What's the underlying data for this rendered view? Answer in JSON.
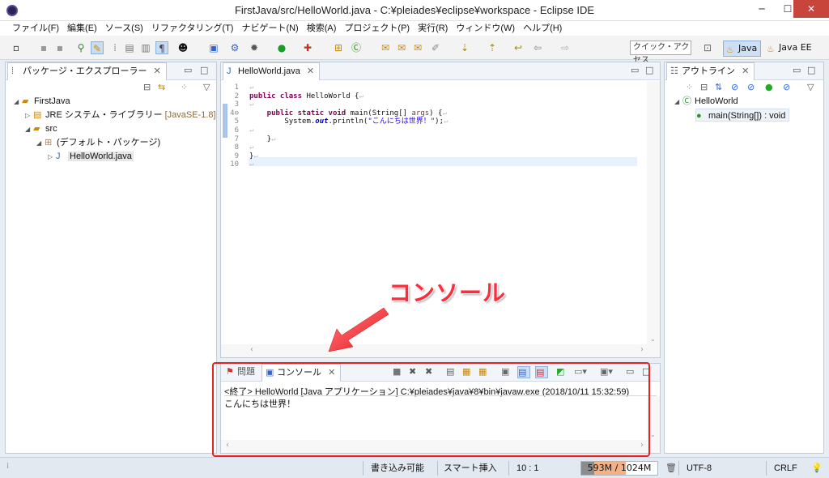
{
  "window": {
    "title": "FirstJava/src/HelloWorld.java - C:¥pleiades¥eclipse¥workspace - Eclipse IDE"
  },
  "menu": [
    "ファイル(F)",
    "編集(E)",
    "ソース(S)",
    "リファクタリング(T)",
    "ナビゲート(N)",
    "検索(A)",
    "プロジェクト(P)",
    "実行(R)",
    "ウィンドウ(W)",
    "ヘルプ(H)"
  ],
  "toolbar": {
    "quick_access": "クイック・アクセス",
    "perspectives": [
      "Java",
      "Java EE"
    ]
  },
  "package_explorer": {
    "tab": "パッケージ・エクスプローラー",
    "tree": [
      {
        "label": "FirstJava",
        "icon": "project-icon"
      },
      {
        "label": "JRE システム・ライブラリー",
        "suffix": "[JavaSE-1.8]",
        "icon": "library-icon"
      },
      {
        "label": "src",
        "icon": "source-folder-icon"
      },
      {
        "label": "(デフォルト・パッケージ)",
        "icon": "package-icon"
      },
      {
        "label": "HelloWorld.java",
        "icon": "java-file-icon"
      }
    ]
  },
  "editor": {
    "tab": "HelloWorld.java",
    "line_numbers": [
      "1",
      "2",
      "3",
      "4⊖",
      "5",
      "6",
      "7",
      "8",
      "9",
      "10"
    ],
    "lines": [
      {
        "parts": []
      },
      {
        "parts": [
          {
            "t": "public class ",
            "c": "kw"
          },
          {
            "t": "HelloWorld {",
            "c": ""
          }
        ]
      },
      {
        "parts": []
      },
      {
        "parts": [
          {
            "t": "    public static void ",
            "c": "kw"
          },
          {
            "t": "main(String[] ",
            "c": ""
          },
          {
            "t": "args",
            "c": "par"
          },
          {
            "t": ") {",
            "c": ""
          }
        ]
      },
      {
        "parts": [
          {
            "t": "        System.",
            "c": ""
          },
          {
            "t": "out",
            "c": "fld"
          },
          {
            "t": ".println(",
            "c": ""
          },
          {
            "t": "\"こんにちは世界！\"",
            "c": "str"
          },
          {
            "t": ");",
            "c": ""
          }
        ]
      },
      {
        "parts": []
      },
      {
        "parts": [
          {
            "t": "    }",
            "c": ""
          }
        ]
      },
      {
        "parts": []
      },
      {
        "parts": [
          {
            "t": "}",
            "c": ""
          }
        ]
      },
      {
        "parts": []
      }
    ]
  },
  "outline": {
    "tab": "アウトライン",
    "tree": [
      {
        "label": "HelloWorld",
        "icon": "class-icon"
      },
      {
        "label": "main(String[]) : void",
        "icon": "method-icon"
      }
    ]
  },
  "console": {
    "tab_problems": "問題",
    "tab_console": "コンソール",
    "header": "<終了> HelloWorld [Java アプリケーション] C:¥pleiades¥java¥8¥bin¥javaw.exe (2018/10/11 15:32:59)",
    "output": "こんにちは世界！"
  },
  "annotation": {
    "label": "コンソール",
    "color": "#ff2b3c"
  },
  "status": {
    "writable": "書き込み可能",
    "insert_mode": "スマート挿入",
    "position": "10 : 1",
    "heap": "593M / 1024M",
    "heap_fraction": 0.58,
    "encoding": "UTF-8",
    "line_delimiter": "CRLF"
  }
}
